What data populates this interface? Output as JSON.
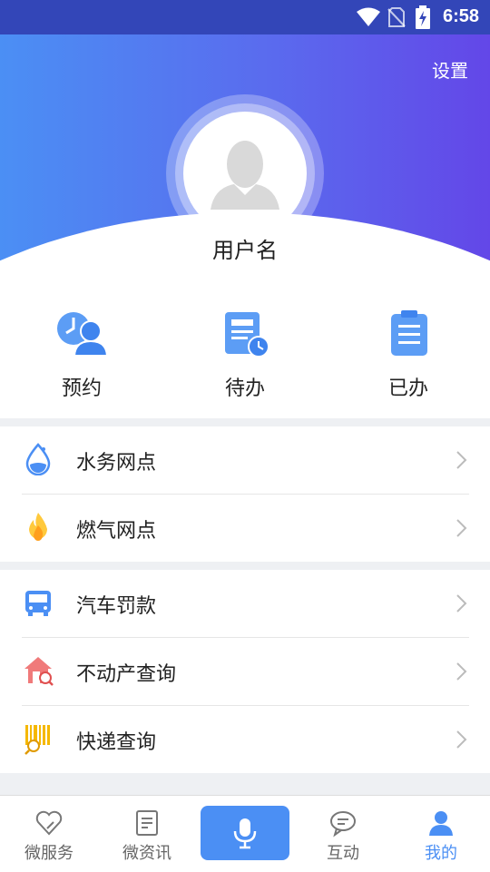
{
  "status_bar": {
    "time": "6:58",
    "icons": [
      "wifi-icon",
      "no-sim-icon",
      "battery-charging-icon"
    ]
  },
  "header": {
    "settings_label": "设置",
    "avatar_icon": "user-avatar-icon",
    "username": "用户名"
  },
  "quick_actions": [
    {
      "label": "预约",
      "icon": "clock-user-icon"
    },
    {
      "label": "待办",
      "icon": "document-clock-icon"
    },
    {
      "label": "已办",
      "icon": "clipboard-icon"
    }
  ],
  "menu_groups": [
    [
      {
        "label": "水务网点",
        "icon": "water-drop-icon"
      },
      {
        "label": "燃气网点",
        "icon": "flame-icon"
      }
    ],
    [
      {
        "label": "汽车罚款",
        "icon": "bus-icon"
      },
      {
        "label": "不动产查询",
        "icon": "house-search-icon"
      },
      {
        "label": "快递查询",
        "icon": "barcode-search-icon"
      }
    ]
  ],
  "tabs": [
    {
      "label": "微服务",
      "icon": "heart-icon",
      "active": false
    },
    {
      "label": "微资讯",
      "icon": "document-icon",
      "active": false
    },
    {
      "label": "",
      "icon": "microphone-icon",
      "active": false
    },
    {
      "label": "互动",
      "icon": "chat-bubble-icon",
      "active": false
    },
    {
      "label": "我的",
      "icon": "person-icon",
      "active": true
    }
  ],
  "colors": {
    "primary": "#4b8ff4",
    "gradient_end": "#6347e8",
    "status_bar": "#3346b8",
    "active_tab": "#4b8ff4",
    "inactive_tab": "#666666"
  }
}
